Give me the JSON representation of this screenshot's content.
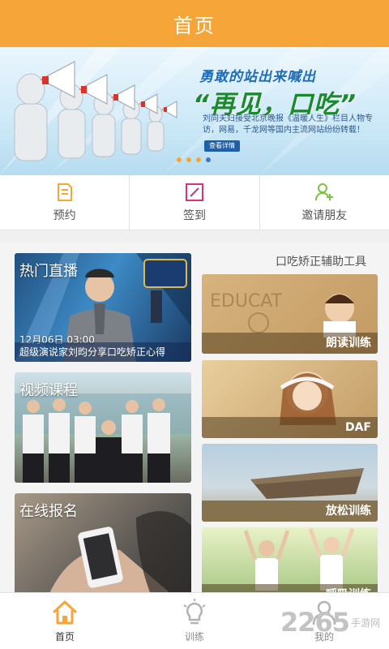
{
  "header": {
    "title": "首页"
  },
  "banner": {
    "slogan": "勇敢的站出来喊出",
    "headline": "“再见，口吃”",
    "description": "刘同夫妇接受北京晚报《温暖人生》栏目人物专访，网易，千龙网等国内主流网站纷纷转载！",
    "detail_button": "查看详情",
    "dots_total": 4,
    "dots_active_index": 3
  },
  "quick_actions": [
    {
      "label": "预约",
      "icon": "document-icon"
    },
    {
      "label": "签到",
      "icon": "checkin-icon"
    },
    {
      "label": "邀请朋友",
      "icon": "add-user-icon"
    }
  ],
  "main": {
    "live": {
      "title": "热门直播",
      "time": "12月06日 03:00",
      "caption": "超级演说家刘昀分享口吃矫正心得"
    },
    "video": {
      "title": "视频课程"
    },
    "signup": {
      "title": "在线报名"
    },
    "tools": {
      "title": "口吃矫正辅助工具",
      "items": [
        {
          "label": "朗读训练"
        },
        {
          "label": "DAF"
        },
        {
          "label": "放松训练"
        },
        {
          "label": "呼吸训练"
        }
      ]
    }
  },
  "bottom_nav": [
    {
      "label": "首页",
      "icon": "home-icon",
      "active": true
    },
    {
      "label": "训练",
      "icon": "lightbulb-icon",
      "active": false
    },
    {
      "label": "我的",
      "icon": "user-icon",
      "active": false
    }
  ],
  "watermark": {
    "number": "2265",
    "text": "手游网"
  },
  "colors": {
    "accent": "#f6a638",
    "banner_blue": "#1f6bb5",
    "banner_green": "#1a8a2e"
  }
}
